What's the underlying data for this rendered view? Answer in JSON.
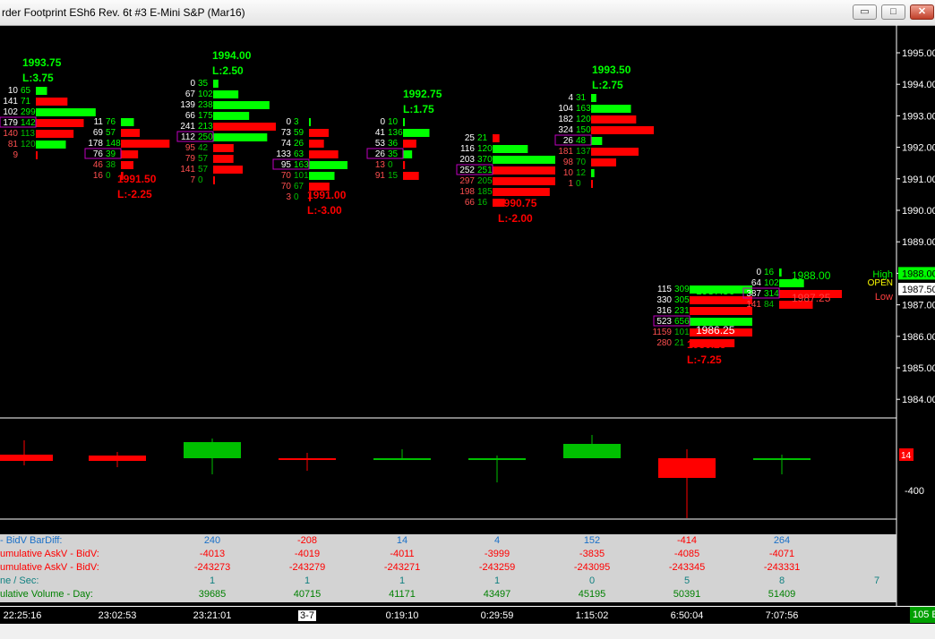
{
  "window": {
    "title": "rder Footprint  ESh6  Rev. 6t  #3  E-Mini S&P (Mar16)",
    "minimize_glyph": "▭",
    "maximize_glyph": "□",
    "close_glyph": "✕"
  },
  "price_axis": {
    "labels": [
      "1995.00",
      "1994.00",
      "1993.00",
      "1992.00",
      "1991.00",
      "1990.00",
      "1989.00",
      "1988.00",
      "1987.00",
      "1986.00",
      "1985.00",
      "1984.00"
    ],
    "current_price": "1987.50",
    "high_marker": "1988.00"
  },
  "legend": {
    "high": "High",
    "open": "OPEN",
    "low": "Low"
  },
  "delta_axis": {
    "label": "-400",
    "marker": "14"
  },
  "annotations": [
    {
      "price": "1993.75",
      "level": "L:3.75",
      "color": "green"
    },
    {
      "price": "1991.50",
      "level": "L:-2.25",
      "color": "red"
    },
    {
      "price": "1994.00",
      "level": "L:2.50",
      "color": "green"
    },
    {
      "price": "1991.00",
      "level": "L:-3.00",
      "color": "red"
    },
    {
      "price": "1992.75",
      "level": "L:1.75",
      "color": "green"
    },
    {
      "price": "1990.75",
      "level": "L:-2.00",
      "color": "red"
    },
    {
      "price": "1993.50",
      "level": "L:2.75",
      "color": "green"
    },
    {
      "price": "1986.25",
      "level": "L:-7.25",
      "color": "red"
    }
  ],
  "footprint_cells": [
    [
      "10",
      "65",
      "141",
      "71",
      "102",
      "299",
      "179",
      "142",
      "140",
      "113",
      "81",
      "120",
      "9"
    ],
    [
      "11",
      "76",
      "69",
      "57",
      "178",
      "148",
      "76",
      "39",
      "46",
      "38",
      "16",
      "0"
    ],
    [
      "0",
      "35",
      "67",
      "102",
      "139",
      "238",
      "66",
      "175",
      "241",
      "213",
      "112",
      "250",
      "95",
      "42",
      "79",
      "57",
      "141",
      "57",
      "7",
      "0"
    ],
    [
      "0",
      "3",
      "73",
      "59",
      "74",
      "26",
      "133",
      "63",
      "95",
      "163",
      "70",
      "101",
      "70",
      "67",
      "3",
      "0"
    ],
    [
      "0",
      "10",
      "41",
      "136",
      "53",
      "36",
      "26",
      "35",
      "13",
      "0",
      "91",
      "15"
    ],
    [
      "25",
      "21",
      "116",
      "120",
      "203",
      "370",
      "252",
      "251",
      "297",
      "205",
      "198",
      "185",
      "66",
      "16"
    ],
    [
      "4",
      "31",
      "104",
      "163",
      "182",
      "120",
      "324",
      "150",
      "26",
      "48",
      "181",
      "137",
      "98",
      "70",
      "10",
      "12",
      "1",
      "0"
    ],
    [
      "115",
      "309",
      "330",
      "305",
      "316",
      "231",
      "523",
      "656",
      "1159",
      "1014",
      "280",
      "21"
    ],
    [
      "0",
      "16",
      "64",
      "102",
      "387",
      "314",
      "141",
      "84"
    ]
  ],
  "side_prices": [
    "1987.50",
    "1988.00",
    "1987.25",
    "1986.25"
  ],
  "indicators": {
    "rows": [
      {
        "label": "- BidV BarDiff:",
        "values": [
          "240",
          "-208",
          "14",
          "4",
          "152",
          "-414",
          "264"
        ]
      },
      {
        "label": "umulative AskV - BidV:",
        "values": [
          "-4013",
          "-4019",
          "-4011",
          "-3999",
          "-3835",
          "-4085",
          "-4071"
        ]
      },
      {
        "label": "umulative AskV - BidV:",
        "values": [
          "-243273",
          "-243279",
          "-243271",
          "-243259",
          "-243095",
          "-243345",
          "-243331"
        ]
      },
      {
        "label": "ne / Sec:",
        "values": [
          "1",
          "1",
          "1",
          "1",
          "0",
          "5",
          "8",
          "7"
        ]
      },
      {
        "label": "ulative Volume - Day:",
        "values": [
          "39685",
          "40715",
          "41171",
          "43497",
          "45195",
          "50391",
          "51409"
        ]
      }
    ]
  },
  "time_axis": {
    "labels": [
      "22:25:16",
      "23:02:53",
      "23:21:01",
      "3-7",
      "0:19:10",
      "0:29:59",
      "1:15:02",
      "6:50:04",
      "7:07:56"
    ],
    "badge": "105 E"
  },
  "colors": {
    "up": "#00ff00",
    "down": "#ff0000",
    "bg": "#000000",
    "poc": "#c000c0"
  },
  "chart_data": {
    "type": "bar",
    "bars": [
      {
        "time": "22:25:16",
        "high": 1994.75,
        "low": 1991.75,
        "delta": 240
      },
      {
        "time": "23:02:53",
        "high": 1993.25,
        "low": 1991.5,
        "delta": -208
      },
      {
        "time": "23:21:01",
        "high": 1994.0,
        "low": 1992.0,
        "delta": 14
      },
      {
        "time": "0:19:10",
        "high": 1993.0,
        "low": 1991.0,
        "delta": 4
      },
      {
        "time": "0:29:59",
        "high": 1992.75,
        "low": 1991.5,
        "delta": 152
      },
      {
        "time": "1:15:02",
        "high": 1992.5,
        "low": 1990.75,
        "delta": -414
      },
      {
        "time": "6:50:04",
        "high": 1993.5,
        "low": 1991.75,
        "delta": 264
      },
      {
        "time": "7:07:56",
        "high": 1987.5,
        "low": 1986.25,
        "delta": 0
      }
    ]
  }
}
